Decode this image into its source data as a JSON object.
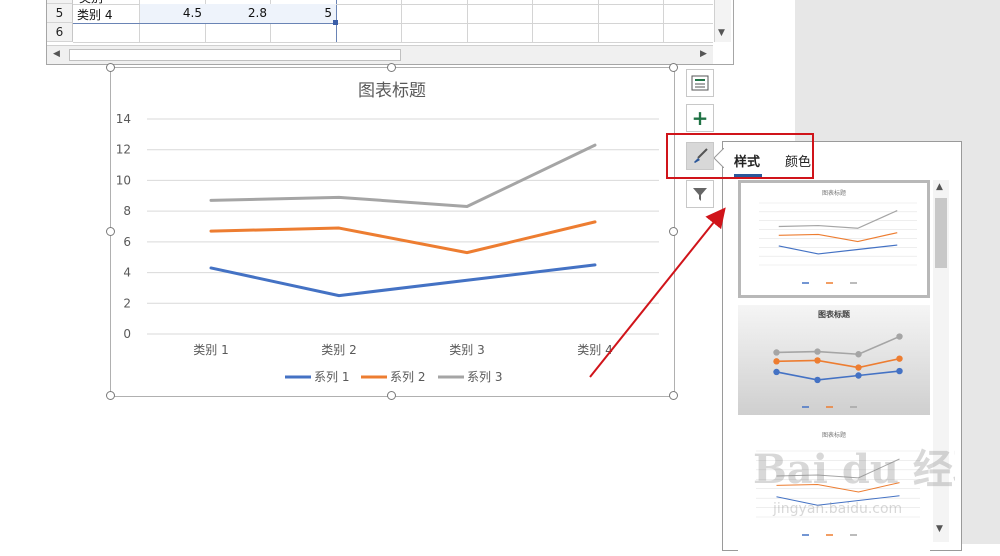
{
  "sheet": {
    "rows": [
      {
        "num": "5",
        "cells": [
          "类别 4",
          "4.5",
          "2.8",
          "5"
        ]
      },
      {
        "num": "6",
        "cells": [
          "",
          "",
          "",
          ""
        ]
      }
    ],
    "row_cut_label": "类别"
  },
  "chart": {
    "title": "图表标题",
    "yticks": [
      "0",
      "2",
      "4",
      "6",
      "8",
      "10",
      "12",
      "14"
    ],
    "categories": [
      "类别 1",
      "类别 2",
      "类别 3",
      "类别 4"
    ],
    "series": [
      {
        "name": "系列 1",
        "color": "#4472c4",
        "values": [
          4.3,
          2.5,
          3.5,
          4.5
        ]
      },
      {
        "name": "系列 2",
        "color": "#ed7d31",
        "values": [
          6.7,
          6.9,
          5.3,
          7.3
        ]
      },
      {
        "name": "系列 3",
        "color": "#a5a5a5",
        "values": [
          8.7,
          8.9,
          8.3,
          12.3
        ]
      }
    ]
  },
  "chart_data": {
    "type": "line",
    "title": "图表标题",
    "categories": [
      "类别 1",
      "类别 2",
      "类别 3",
      "类别 4"
    ],
    "series": [
      {
        "name": "系列 1",
        "values": [
          4.3,
          2.5,
          3.5,
          4.5
        ]
      },
      {
        "name": "系列 2",
        "values": [
          6.7,
          6.9,
          5.3,
          7.3
        ]
      },
      {
        "name": "系列 3",
        "values": [
          8.7,
          8.9,
          8.3,
          12.3
        ]
      }
    ],
    "ylim": [
      0,
      14
    ],
    "grid": true,
    "legend": "bottom"
  },
  "tools": [
    {
      "name": "chart-layout-button",
      "icon": "layout-icon"
    },
    {
      "name": "chart-elements-button",
      "icon": "plus-icon"
    },
    {
      "name": "chart-styles-button",
      "icon": "brush-icon"
    },
    {
      "name": "chart-filters-button",
      "icon": "filter-icon"
    }
  ],
  "flyout": {
    "tabs": [
      "样式",
      "颜色"
    ],
    "thumb_titles": [
      "图表标题",
      "图表标题",
      "图表标题"
    ]
  },
  "watermark": {
    "text": "Bai du 经验",
    "url": "jingyan.baidu.com"
  },
  "colors": {
    "annotation_red": "#d0141a",
    "accent_blue": "#2b579a",
    "excel_green": "#217346"
  }
}
